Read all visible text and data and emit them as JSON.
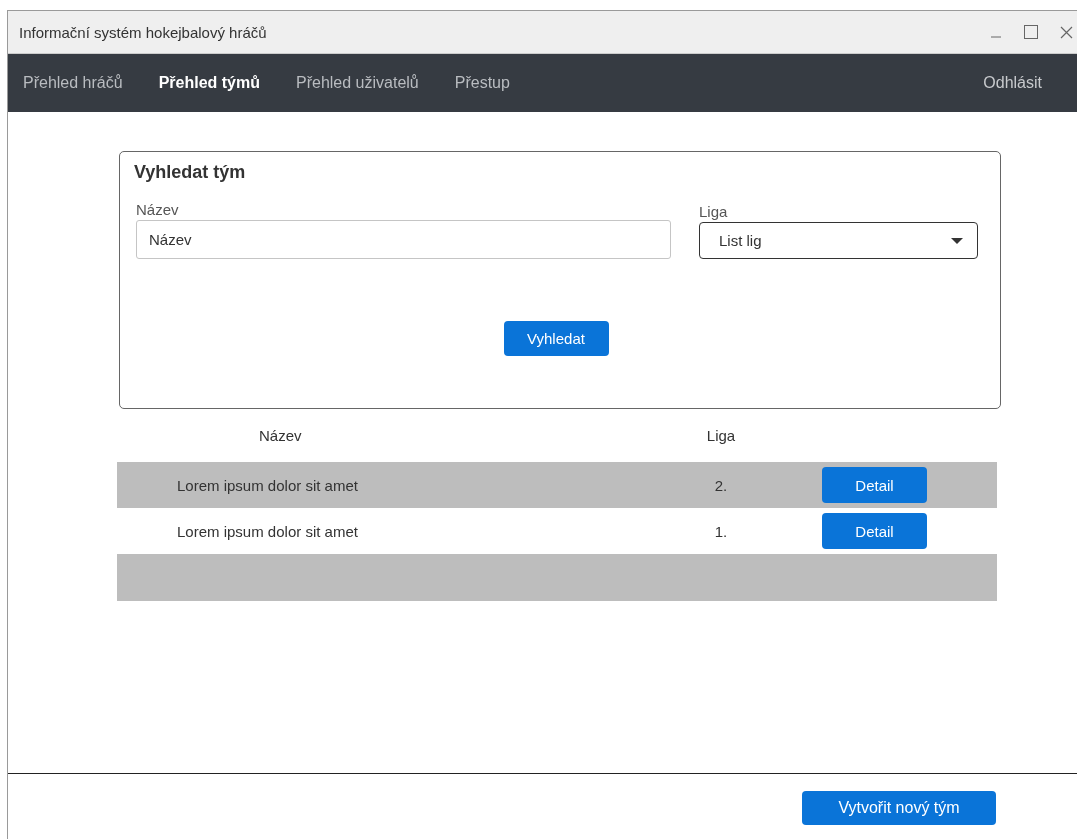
{
  "window": {
    "title": "Informační systém hokejbalový hráčů"
  },
  "nav": {
    "items": [
      {
        "label": "Přehled hráčů",
        "selected": false
      },
      {
        "label": "Přehled týmů",
        "selected": true
      },
      {
        "label": "Přehled uživatelů",
        "selected": false
      },
      {
        "label": "Přestup",
        "selected": false
      }
    ],
    "logout": "Odhlásit"
  },
  "search": {
    "title": "Vyhledat tým",
    "name_label": "Název",
    "name_placeholder": "Název",
    "league_label": "Liga",
    "league_value": "List lig",
    "button": "Vyhledat"
  },
  "table": {
    "columns": [
      "Název",
      "Liga"
    ],
    "rows": [
      {
        "name": "Lorem ipsum dolor sit amet",
        "league": "2.",
        "button": "Detail"
      },
      {
        "name": "Lorem ipsum dolor sit amet",
        "league": "1.",
        "button": "Detail"
      }
    ]
  },
  "footer": {
    "button": "Vytvořit nový tým"
  }
}
